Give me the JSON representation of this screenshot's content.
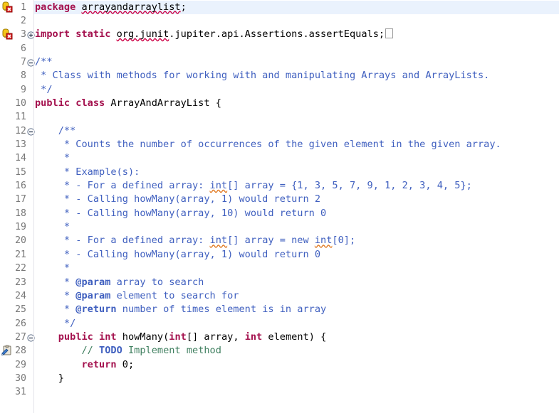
{
  "editor": {
    "name": "java-source-editor",
    "language": "Java",
    "current_line": 1,
    "colors": {
      "background": "#ffffff",
      "current_line_highlight": "#eaf2fd",
      "keyword": "#a4114e",
      "javadoc": "#3f5fbf",
      "comment": "#3f7f5f",
      "line_number": "#787878",
      "error_squiggle": "#cc0044",
      "spelling_squiggle": "#e07820",
      "gutter_separator": "#e4e4ea"
    }
  },
  "lines": [
    {
      "number": "1",
      "marker": "error-marker",
      "fold": "",
      "highlight": true,
      "tokens": [
        {
          "text": "package",
          "style": "kw"
        },
        {
          "text": " ",
          "style": "plain"
        },
        {
          "text": "arrayandarraylist",
          "style": "err"
        },
        {
          "text": ";",
          "style": "plain"
        }
      ]
    },
    {
      "number": "2",
      "marker": "",
      "fold": "",
      "highlight": false,
      "tokens": []
    },
    {
      "number": "3",
      "marker": "error-marker",
      "fold": "collapsed",
      "highlight": false,
      "tokens": [
        {
          "text": "import",
          "style": "kw"
        },
        {
          "text": " ",
          "style": "plain"
        },
        {
          "text": "static",
          "style": "kw"
        },
        {
          "text": " ",
          "style": "plain"
        },
        {
          "text": "org.junit",
          "style": "err"
        },
        {
          "text": ".jupiter.api.Assertions.assertEquals;",
          "style": "plain"
        },
        {
          "text": " ",
          "style": "foldbox"
        }
      ]
    },
    {
      "number": "6",
      "marker": "",
      "fold": "",
      "highlight": false,
      "tokens": []
    },
    {
      "number": "7",
      "marker": "",
      "fold": "expanded",
      "highlight": false,
      "tokens": [
        {
          "text": "/**",
          "style": "doc"
        }
      ]
    },
    {
      "number": "8",
      "marker": "",
      "fold": "",
      "highlight": false,
      "tokens": [
        {
          "text": " * Class with methods for working with and manipulating Arrays and ArrayLists.",
          "style": "doc"
        }
      ]
    },
    {
      "number": "9",
      "marker": "",
      "fold": "",
      "highlight": false,
      "tokens": [
        {
          "text": " */",
          "style": "doc"
        }
      ]
    },
    {
      "number": "10",
      "marker": "",
      "fold": "",
      "highlight": false,
      "tokens": [
        {
          "text": "public",
          "style": "kw"
        },
        {
          "text": " ",
          "style": "plain"
        },
        {
          "text": "class",
          "style": "kw"
        },
        {
          "text": " ArrayAndArrayList {",
          "style": "plain"
        }
      ]
    },
    {
      "number": "11",
      "marker": "",
      "fold": "",
      "highlight": false,
      "tokens": []
    },
    {
      "number": "12",
      "marker": "",
      "fold": "expanded",
      "highlight": false,
      "tokens": [
        {
          "text": "    /**",
          "style": "doc"
        }
      ]
    },
    {
      "number": "13",
      "marker": "",
      "fold": "",
      "highlight": false,
      "tokens": [
        {
          "text": "     * Counts the number of occurrences of the given element in the given array.",
          "style": "doc"
        }
      ]
    },
    {
      "number": "14",
      "marker": "",
      "fold": "",
      "highlight": false,
      "tokens": [
        {
          "text": "     *",
          "style": "doc"
        }
      ]
    },
    {
      "number": "15",
      "marker": "",
      "fold": "",
      "highlight": false,
      "tokens": [
        {
          "text": "     * Example(s):",
          "style": "doc"
        }
      ]
    },
    {
      "number": "16",
      "marker": "",
      "fold": "",
      "highlight": false,
      "tokens": [
        {
          "text": "     * - For a defined array: ",
          "style": "doc"
        },
        {
          "text": "int",
          "style": "doc spell"
        },
        {
          "text": "[] array = {1, 3, 5, 7, 9, 1, 2, 3, 4, 5};",
          "style": "doc"
        }
      ]
    },
    {
      "number": "17",
      "marker": "",
      "fold": "",
      "highlight": false,
      "tokens": [
        {
          "text": "     * - Calling howMany(array, 1) would return 2",
          "style": "doc"
        }
      ]
    },
    {
      "number": "18",
      "marker": "",
      "fold": "",
      "highlight": false,
      "tokens": [
        {
          "text": "     * - Calling howMany(array, 10) would return 0",
          "style": "doc"
        }
      ]
    },
    {
      "number": "19",
      "marker": "",
      "fold": "",
      "highlight": false,
      "tokens": [
        {
          "text": "     *",
          "style": "doc"
        }
      ]
    },
    {
      "number": "20",
      "marker": "",
      "fold": "",
      "highlight": false,
      "tokens": [
        {
          "text": "     * - For a defined array: ",
          "style": "doc"
        },
        {
          "text": "int",
          "style": "doc spell"
        },
        {
          "text": "[] array = new ",
          "style": "doc"
        },
        {
          "text": "int",
          "style": "doc spell"
        },
        {
          "text": "[0];",
          "style": "doc"
        }
      ]
    },
    {
      "number": "21",
      "marker": "",
      "fold": "",
      "highlight": false,
      "tokens": [
        {
          "text": "     * - Calling howMany(array, 1) would return 0",
          "style": "doc"
        }
      ]
    },
    {
      "number": "22",
      "marker": "",
      "fold": "",
      "highlight": false,
      "tokens": [
        {
          "text": "     *",
          "style": "doc"
        }
      ]
    },
    {
      "number": "23",
      "marker": "",
      "fold": "",
      "highlight": false,
      "tokens": [
        {
          "text": "     * ",
          "style": "doc"
        },
        {
          "text": "@param",
          "style": "doctag"
        },
        {
          "text": " array to search",
          "style": "doc"
        }
      ]
    },
    {
      "number": "24",
      "marker": "",
      "fold": "",
      "highlight": false,
      "tokens": [
        {
          "text": "     * ",
          "style": "doc"
        },
        {
          "text": "@param",
          "style": "doctag"
        },
        {
          "text": " element to search for",
          "style": "doc"
        }
      ]
    },
    {
      "number": "25",
      "marker": "",
      "fold": "",
      "highlight": false,
      "tokens": [
        {
          "text": "     * ",
          "style": "doc"
        },
        {
          "text": "@return",
          "style": "doctag"
        },
        {
          "text": " number of times element is in array",
          "style": "doc"
        }
      ]
    },
    {
      "number": "26",
      "marker": "",
      "fold": "",
      "highlight": false,
      "tokens": [
        {
          "text": "     */",
          "style": "doc"
        }
      ]
    },
    {
      "number": "27",
      "marker": "",
      "fold": "expanded",
      "highlight": false,
      "tokens": [
        {
          "text": "    ",
          "style": "plain"
        },
        {
          "text": "public",
          "style": "kw"
        },
        {
          "text": " ",
          "style": "plain"
        },
        {
          "text": "int",
          "style": "kw"
        },
        {
          "text": " howMany(",
          "style": "plain"
        },
        {
          "text": "int",
          "style": "kw"
        },
        {
          "text": "[] array, ",
          "style": "plain"
        },
        {
          "text": "int",
          "style": "kw"
        },
        {
          "text": " element) {",
          "style": "plain"
        }
      ]
    },
    {
      "number": "28",
      "marker": "task-marker",
      "fold": "",
      "highlight": false,
      "tokens": [
        {
          "text": "        ",
          "style": "plain"
        },
        {
          "text": "// ",
          "style": "cmt"
        },
        {
          "text": "TODO",
          "style": "todo"
        },
        {
          "text": " Implement method",
          "style": "cmt"
        }
      ]
    },
    {
      "number": "29",
      "marker": "",
      "fold": "",
      "highlight": false,
      "tokens": [
        {
          "text": "        ",
          "style": "plain"
        },
        {
          "text": "return",
          "style": "kw"
        },
        {
          "text": " 0;",
          "style": "plain"
        }
      ]
    },
    {
      "number": "30",
      "marker": "",
      "fold": "",
      "highlight": false,
      "tokens": [
        {
          "text": "    }",
          "style": "plain"
        }
      ]
    },
    {
      "number": "31",
      "marker": "",
      "fold": "",
      "highlight": false,
      "tokens": []
    }
  ]
}
